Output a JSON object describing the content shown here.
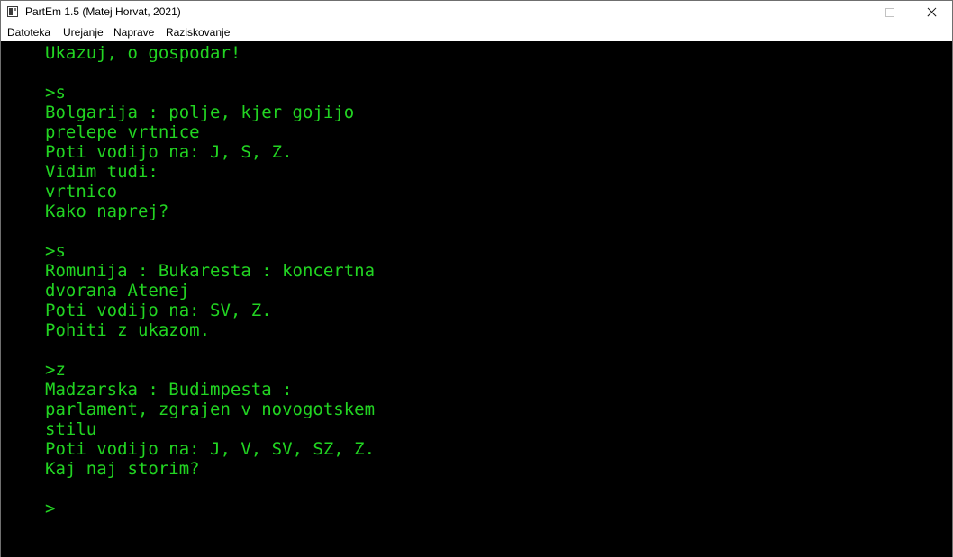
{
  "window": {
    "title": "PartEm 1.5 (Matej Horvat, 2021)"
  },
  "menu": {
    "items": [
      "Datoteka",
      "Urejanje",
      "Naprave",
      "Raziskovanje"
    ]
  },
  "terminal": {
    "text_color": "#22d422",
    "background": "#000000",
    "lines": [
      "Ukazuj, o gospodar!",
      "",
      ">s",
      "Bolgarija : polje, kjer gojijo",
      "prelepe vrtnice",
      "Poti vodijo na: J, S, Z.",
      "Vidim tudi:",
      "vrtnico",
      "Kako naprej?",
      "",
      ">s",
      "Romunija : Bukaresta : koncertna",
      "dvorana Atenej",
      "Poti vodijo na: SV, Z.",
      "Pohiti z ukazom.",
      "",
      ">z",
      "Madzarska : Budimpesta :",
      "parlament, zgrajen v novogotskem",
      "stilu",
      "Poti vodijo na: J, V, SV, SZ, Z.",
      "Kaj naj storim?",
      "",
      ">"
    ]
  }
}
